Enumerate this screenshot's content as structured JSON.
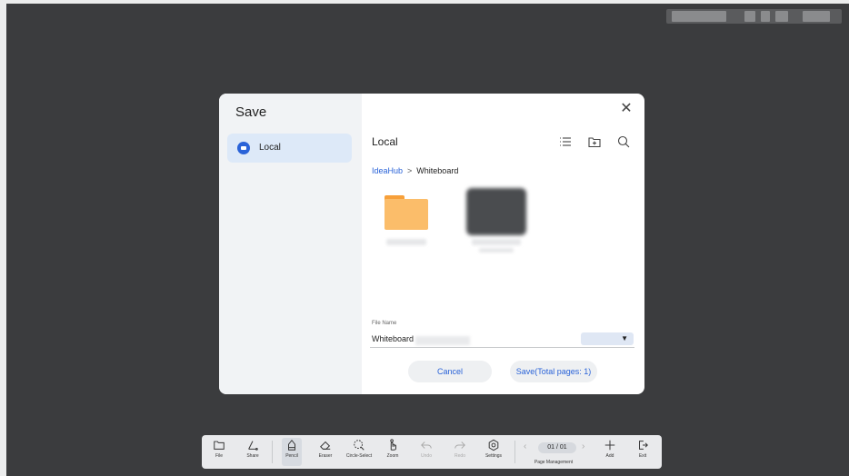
{
  "dialog": {
    "title": "Save",
    "sidebar": {
      "items": [
        {
          "label": "Local",
          "icon": "cloud-folder-icon",
          "selected": true
        }
      ]
    },
    "main": {
      "title": "Local",
      "toolbar_icons": [
        "list-view-icon",
        "new-folder-icon",
        "search-icon"
      ],
      "breadcrumb": {
        "root": "IdeaHub",
        "separator": ">",
        "current": "Whiteboard"
      },
      "files": [
        {
          "kind": "folder",
          "icon": "folder-icon"
        },
        {
          "kind": "whiteboard-file",
          "icon": "file-thumbnail"
        }
      ],
      "file_name": {
        "label": "File Name",
        "value": "Whiteboard"
      },
      "cancel_label": "Cancel",
      "save_label": "Save(Total pages: 1)"
    }
  },
  "toolbar": {
    "items": [
      {
        "label": "File",
        "icon": "folder-icon"
      },
      {
        "label": "Share",
        "icon": "share-icon"
      },
      {
        "label": "Pencil",
        "icon": "pencil-icon",
        "active": true
      },
      {
        "label": "Eraser",
        "icon": "eraser-icon"
      },
      {
        "label": "Circle-Select",
        "icon": "lasso-icon"
      },
      {
        "label": "Zoom",
        "icon": "hand-zoom-icon"
      },
      {
        "label": "Undo",
        "icon": "undo-icon",
        "disabled": true
      },
      {
        "label": "Redo",
        "icon": "redo-icon",
        "disabled": true
      },
      {
        "label": "Settings",
        "icon": "gear-icon"
      }
    ],
    "page": {
      "current": "01 / 01",
      "label": "Page Management"
    },
    "add_label": "Add",
    "exit_label": "Exit"
  },
  "colors": {
    "accent": "#2a63d8",
    "folder": "#fbbd6a",
    "background": "#3b3c3e"
  }
}
